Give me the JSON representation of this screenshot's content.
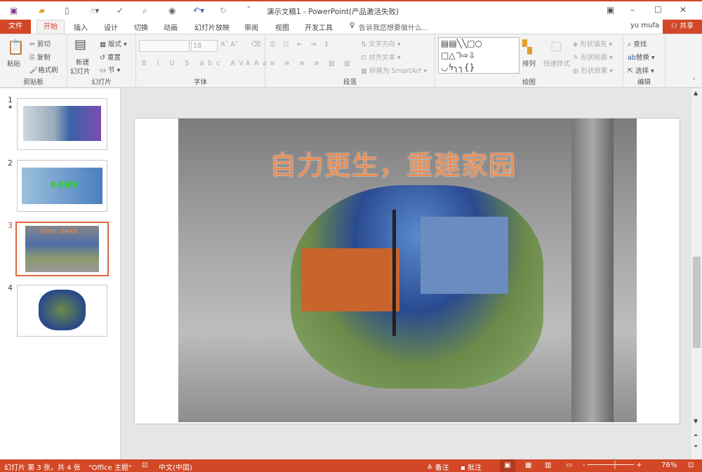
{
  "window": {
    "title": "演示文稿1 - PowerPoint(产品激活失败)"
  },
  "tabs": {
    "file": "文件",
    "items": [
      "开始",
      "插入",
      "设计",
      "切换",
      "动画",
      "幻灯片放映",
      "审阅",
      "视图",
      "开发工具"
    ],
    "tell_me": "告诉我您想要做什么...",
    "user": "yu mufa",
    "share": "共享"
  },
  "ribbon": {
    "clipboard": {
      "paste": "粘贴",
      "cut": "剪切",
      "copy": "复制",
      "format_painter": "格式刷",
      "label": "剪贴板"
    },
    "slides": {
      "new_slide": "新建",
      "new_slide2": "幻灯片",
      "layout": "版式",
      "reset": "重置",
      "section": "节",
      "label": "幻灯片"
    },
    "font": {
      "size": "18",
      "label": "字体"
    },
    "paragraph": {
      "text_direction": "文字方向",
      "align_text": "对齐文本",
      "smartart": "转换为 SmartArt",
      "label": "段落"
    },
    "drawing": {
      "arrange": "排列",
      "quick_styles": "快速样式",
      "shape_fill": "形状填充",
      "shape_outline": "形状轮廓",
      "shape_effects": "形状效果",
      "label": "绘图"
    },
    "editing": {
      "find": "查找",
      "replace": "替换",
      "select": "选择",
      "label": "编辑"
    }
  },
  "thumbnails": [
    {
      "num": "1",
      "star": "★"
    },
    {
      "num": "2",
      "text": "冬去春来"
    },
    {
      "num": "3",
      "text": "自力更生，重建家园"
    },
    {
      "num": "4"
    }
  ],
  "slide": {
    "title": "自力更生，重建家园"
  },
  "status": {
    "slide_info": "幻灯片 第 3 张，共 4 张",
    "theme": "\"Office 主题\"",
    "language": "中文(中国)",
    "notes": "备注",
    "comments": "批注",
    "zoom": "76%"
  },
  "colors": {
    "accent": "#d24726",
    "title_text": "#f08a4b"
  }
}
